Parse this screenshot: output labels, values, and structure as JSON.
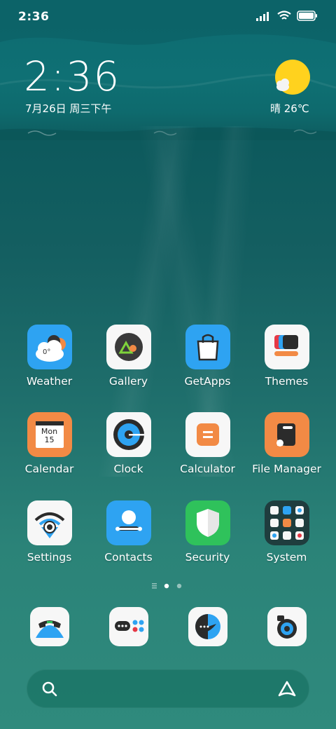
{
  "status_bar": {
    "time": "2:36"
  },
  "clock_widget": {
    "time": "2:36",
    "date": "7月26日 周三下午"
  },
  "weather_widget": {
    "condition_temp": "晴 26℃",
    "icon": "sunny-icon"
  },
  "apps": [
    {
      "name": "Weather",
      "icon": "weather-icon",
      "color": "#2ea3f2",
      "badge_text": "0°"
    },
    {
      "name": "Gallery",
      "icon": "gallery-icon"
    },
    {
      "name": "GetApps",
      "icon": "getapps-icon",
      "color": "#2ea3f2"
    },
    {
      "name": "Themes",
      "icon": "themes-icon"
    },
    {
      "name": "Calendar",
      "icon": "calendar-icon",
      "color": "#f28a45",
      "day_name": "Mon",
      "day_number": "15"
    },
    {
      "name": "Clock",
      "icon": "clock-icon"
    },
    {
      "name": "Calculator",
      "icon": "calculator-icon"
    },
    {
      "name": "File Manager",
      "icon": "file-manager-icon",
      "color": "#f28a45"
    },
    {
      "name": "Settings",
      "icon": "settings-icon"
    },
    {
      "name": "Contacts",
      "icon": "contacts-icon",
      "color": "#2ea3f2"
    },
    {
      "name": "Security",
      "icon": "security-icon",
      "color": "#2fc25b"
    },
    {
      "name": "System",
      "icon": "system-folder-icon"
    }
  ],
  "page_indicator": {
    "pages": 2,
    "current": 1
  },
  "dock": [
    {
      "icon": "phone-icon"
    },
    {
      "icon": "messaging-icon"
    },
    {
      "icon": "browser-icon"
    },
    {
      "icon": "camera-icon"
    }
  ],
  "search_bar": {
    "left_icon": "search-icon",
    "right_icon": "assistant-icon"
  }
}
